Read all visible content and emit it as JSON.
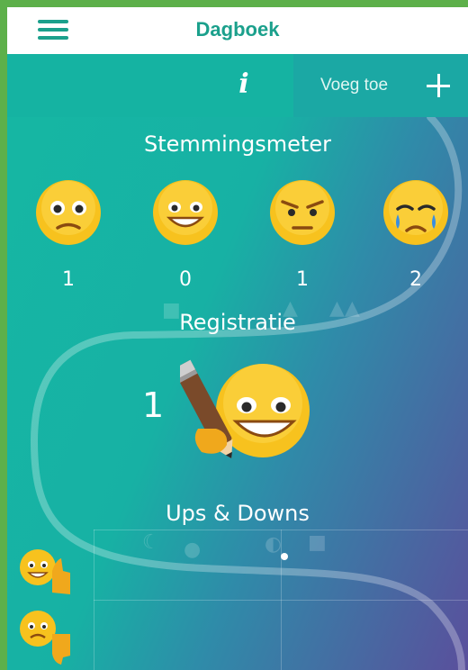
{
  "header": {
    "title": "Dagboek",
    "menu_icon": "hamburger-menu-icon"
  },
  "toolbar": {
    "info_label": "i",
    "add_label": "Voeg toe",
    "add_icon": "plus-icon"
  },
  "mood_meter": {
    "title": "Stemmingsmeter",
    "moods": [
      {
        "icon": "worried-face-icon",
        "count": "1"
      },
      {
        "icon": "smiling-face-icon",
        "count": "0"
      },
      {
        "icon": "angry-face-icon",
        "count": "1"
      },
      {
        "icon": "crying-face-icon",
        "count": "2"
      }
    ]
  },
  "registration": {
    "title": "Registratie",
    "count": "1",
    "icon": "face-with-pencil-icon"
  },
  "ups_downs": {
    "title": "Ups & Downs",
    "up_icon": "thumb-up-face-icon",
    "down_icon": "thumb-down-face-icon",
    "category_icons": [
      "moon-icon",
      "food-icon",
      "banana-icon",
      "house-icon"
    ]
  },
  "colors": {
    "frame": "#5db04a",
    "accent": "#1ba08c",
    "gradient_start": "#16b7a3",
    "gradient_end": "#5a4f9c",
    "emoji_yellow": "#f7c21e"
  }
}
